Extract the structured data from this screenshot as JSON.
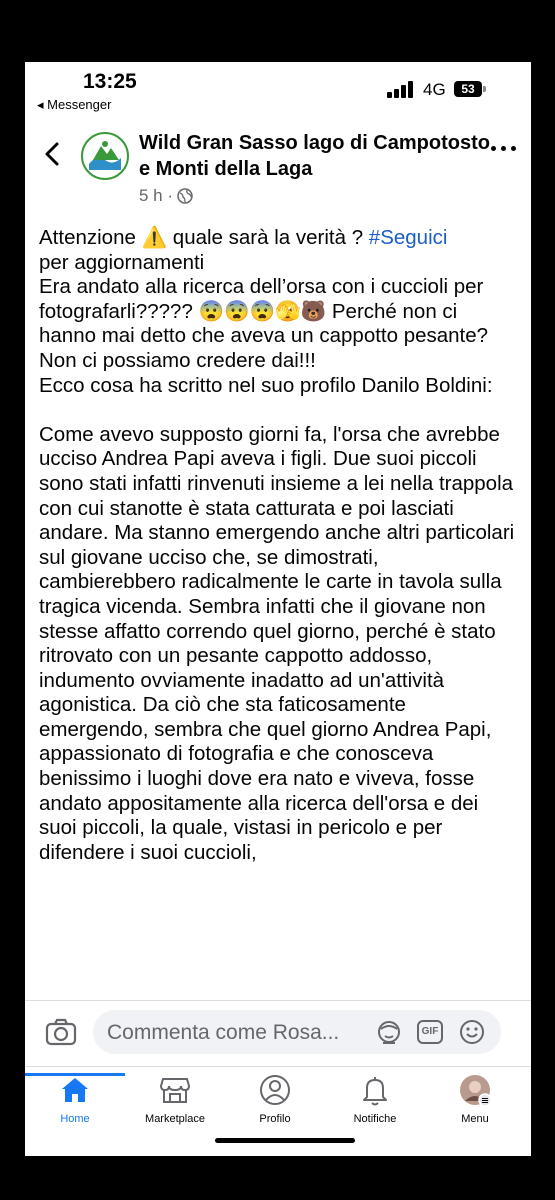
{
  "status_bar": {
    "time": "13:25",
    "back_app": "◂ Messenger",
    "network": "4G",
    "battery": "53"
  },
  "post": {
    "page_name": "Wild Gran Sasso lago di Campotosto e Monti della Laga",
    "time_ago": "5 h ·",
    "text_part1": "Attenzione ⚠️ quale sarà la verità ? ",
    "hashtag": "#Seguici",
    "text_part2": "\nper aggiornamenti\nEra andato alla ricerca dell’orsa con i cuccioli per fotografarli????? 😨😨😨🫣🐻 Perché non ci hanno mai detto che aveva un cappotto pesante?  Non ci possiamo credere dai!!!\nEcco cosa ha scritto nel suo profilo Danilo Boldini:\n\nCome avevo supposto giorni fa, l'orsa che avrebbe ucciso Andrea Papi aveva i figli. Due suoi piccoli sono stati infatti rinvenuti insieme a lei nella trappola con cui stanotte è stata catturata e poi lasciati andare. Ma stanno emergendo anche altri particolari sul giovane ucciso che, se dimostrati, cambierebbero radicalmente le carte in tavola sulla tragica vicenda. Sembra infatti che il giovane non stesse affatto correndo quel giorno, perché è stato ritrovato con un pesante cappotto addosso, indumento ovviamente inadatto ad un'attività agonistica. Da ciò che sta faticosamente emergendo, sembra che quel giorno Andrea Papi, appassionato di fotografia e che conosceva benissimo i luoghi dove era nato e viveva, fosse andato appositamente alla ricerca dell'orsa e dei suoi piccoli, la quale, vistasi in pericolo e per difendere i suoi cuccioli,"
  },
  "comment": {
    "placeholder": "Commenta come Rosa..."
  },
  "tabs": [
    {
      "label": "Home",
      "icon": "home-icon"
    },
    {
      "label": "Marketplace",
      "icon": "marketplace-icon"
    },
    {
      "label": "Profilo",
      "icon": "profile-icon"
    },
    {
      "label": "Notifiche",
      "icon": "bell-icon"
    },
    {
      "label": "Menu",
      "icon": "menu-avatar-icon"
    }
  ],
  "colors": {
    "accent": "#1877f2",
    "hashtag": "#1b5fc4",
    "secondary_text": "#65676b"
  }
}
